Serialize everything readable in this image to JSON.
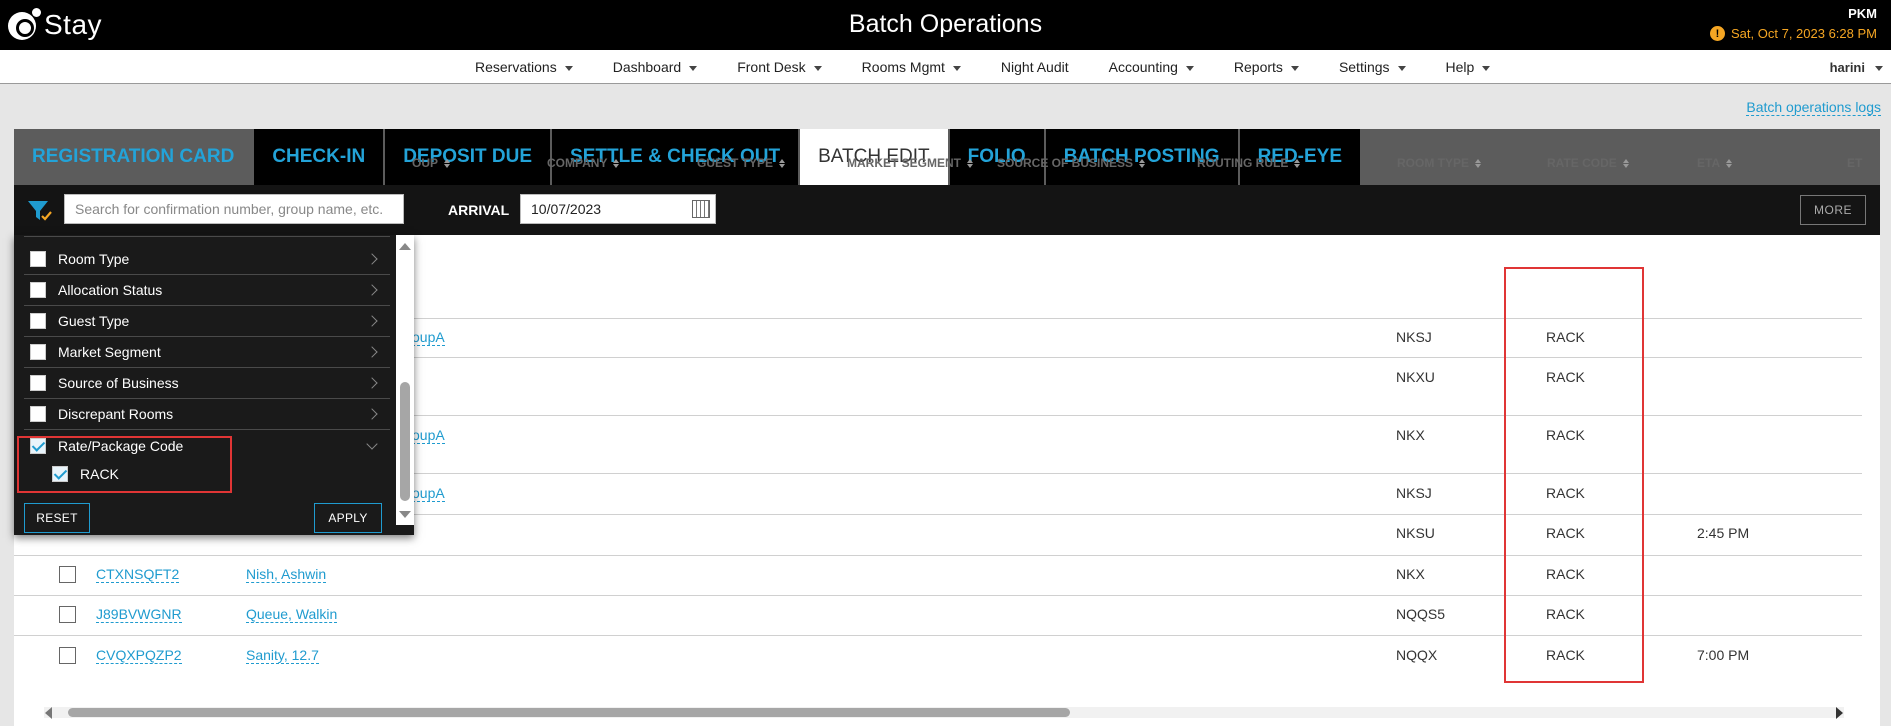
{
  "header": {
    "logo_text": "Stay",
    "title": "Batch Operations",
    "hotel_code": "PKM",
    "business_date": "Sat, Oct 7, 2023 6:28 PM"
  },
  "menu": {
    "items": [
      {
        "label": "Reservations",
        "dropdown": true
      },
      {
        "label": "Dashboard",
        "dropdown": true
      },
      {
        "label": "Front Desk",
        "dropdown": true
      },
      {
        "label": "Rooms Mgmt",
        "dropdown": true
      },
      {
        "label": "Night Audit",
        "dropdown": false
      },
      {
        "label": "Accounting",
        "dropdown": true
      },
      {
        "label": "Reports",
        "dropdown": true
      },
      {
        "label": "Settings",
        "dropdown": true
      },
      {
        "label": "Help",
        "dropdown": true
      }
    ],
    "user": "harini"
  },
  "logs_link": "Batch operations logs",
  "tabs": [
    {
      "label": "REGISTRATION CARD",
      "active": false
    },
    {
      "label": "CHECK-IN",
      "active": false
    },
    {
      "label": "DEPOSIT DUE",
      "active": false
    },
    {
      "label": "SETTLE & CHECK OUT",
      "active": false
    },
    {
      "label": "BATCH EDIT",
      "active": true
    },
    {
      "label": "FOLIO",
      "active": false
    },
    {
      "label": "BATCH POSTING",
      "active": false
    },
    {
      "label": "RED-EYE",
      "active": false
    }
  ],
  "filterbar": {
    "search_placeholder": "Search for confirmation number, group name, etc.",
    "arrival_label": "ARRIVAL",
    "arrival_value": "10/07/2023",
    "more_label": "MORE"
  },
  "table": {
    "columns": [
      {
        "key": "group",
        "label": "OUP"
      },
      {
        "key": "company",
        "label": "COMPANY"
      },
      {
        "key": "guest_type",
        "label": "GUEST TYPE"
      },
      {
        "key": "market_segment",
        "label": "MARKET SEGMENT"
      },
      {
        "key": "source_of_business",
        "label": "SOURCE OF BUSINESS"
      },
      {
        "key": "routing_rule",
        "label": "ROUTING RULE"
      },
      {
        "key": "room_type",
        "label": "ROOM TYPE"
      },
      {
        "key": "rate_code",
        "label": "RATE CODE"
      },
      {
        "key": "eta",
        "label": "ETA"
      },
      {
        "key": "etd",
        "label": "ET"
      }
    ],
    "rows": [
      {
        "confirmation": "",
        "guest": "",
        "group": "oupA",
        "room_type": "NKSJ",
        "rate_code": "RACK",
        "eta": ""
      },
      {
        "confirmation": "",
        "guest": "",
        "group": "",
        "room_type": "NKXU",
        "rate_code": "RACK",
        "eta": ""
      },
      {
        "confirmation": "",
        "guest": "",
        "group": "oupA",
        "room_type": "NKX",
        "rate_code": "RACK",
        "eta": ""
      },
      {
        "confirmation": "",
        "guest": "",
        "group": "oupA",
        "room_type": "NKSJ",
        "rate_code": "RACK",
        "eta": ""
      },
      {
        "confirmation": "",
        "guest": "",
        "group": "",
        "room_type": "NKSU",
        "rate_code": "RACK",
        "eta": "2:45 PM"
      },
      {
        "confirmation": "CTXNSQFT2",
        "guest": "Nish, Ashwin",
        "group": "",
        "room_type": "NKX",
        "rate_code": "RACK",
        "eta": ""
      },
      {
        "confirmation": "J89BVWGNR",
        "guest": "Queue, Walkin",
        "group": "",
        "room_type": "NQQS5",
        "rate_code": "RACK",
        "eta": ""
      },
      {
        "confirmation": "CVQXPQZP2",
        "guest": "Sanity, 12.7",
        "group": "",
        "room_type": "NQQX",
        "rate_code": "RACK",
        "eta": "7:00 PM"
      }
    ]
  },
  "filter_dropdown": {
    "items": [
      {
        "label": "Room Type",
        "checked": false,
        "expanded": false
      },
      {
        "label": "Allocation Status",
        "checked": false,
        "expanded": false
      },
      {
        "label": "Guest Type",
        "checked": false,
        "expanded": false
      },
      {
        "label": "Market Segment",
        "checked": false,
        "expanded": false
      },
      {
        "label": "Source of Business",
        "checked": false,
        "expanded": false
      },
      {
        "label": "Discrepant Rooms",
        "checked": false,
        "expanded": false
      },
      {
        "label": "Rate/Package Code",
        "checked": true,
        "expanded": true
      }
    ],
    "sub_options": [
      {
        "label": "RACK",
        "checked": true
      }
    ],
    "reset_label": "RESET",
    "apply_label": "APPLY"
  },
  "colors": {
    "accent": "#1f9bcf",
    "header_bg": "#000000",
    "date_warning": "#f5a623",
    "highlight": "#e03535"
  }
}
